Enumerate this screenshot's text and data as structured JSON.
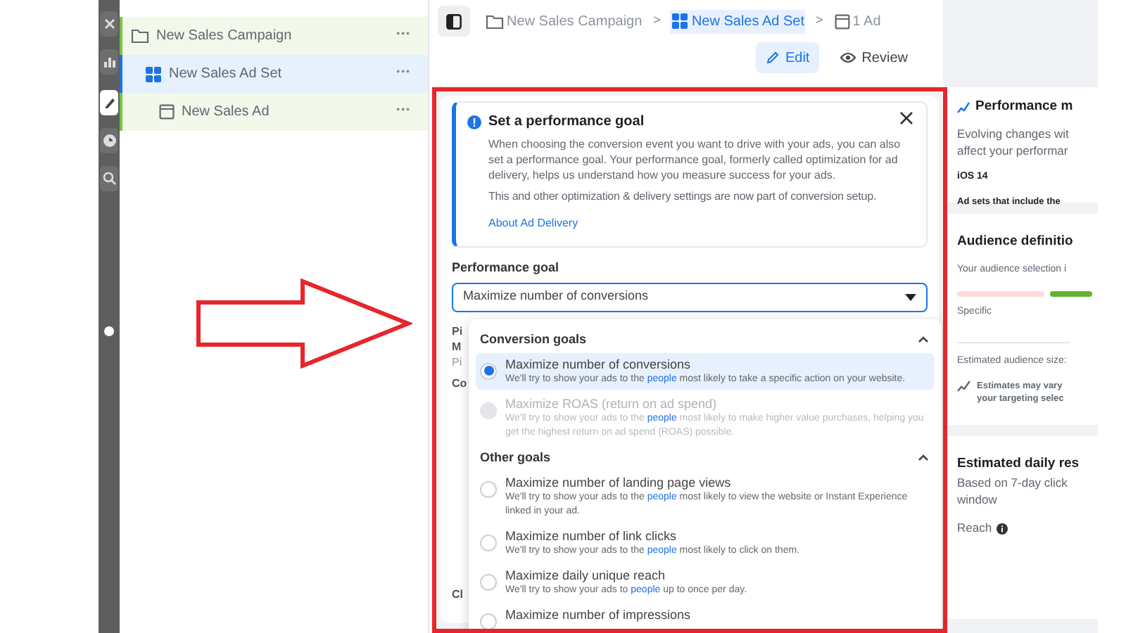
{
  "rail": [
    {
      "kind": "close",
      "selected": false
    },
    {
      "kind": "chart",
      "selected": false
    },
    {
      "kind": "pencil",
      "selected": true
    },
    {
      "kind": "clock",
      "selected": false
    },
    {
      "kind": "search",
      "selected": false
    }
  ],
  "tree": [
    {
      "label": "New Sales Campaign",
      "kind": "campaign",
      "selected": false,
      "more": "•••",
      "children": [
        {
          "label": "New Sales Ad Set",
          "kind": "adset",
          "selected": true,
          "more": "•••",
          "children": [
            {
              "label": "New Sales Ad",
              "kind": "ad",
              "selected": false,
              "more": "•••"
            }
          ]
        }
      ]
    }
  ],
  "breadcrumb": [
    {
      "label": "New Sales Campaign",
      "kind": "campaign",
      "selected": false
    },
    {
      "label": "New Sales Ad Set",
      "kind": "adset",
      "selected": true
    },
    {
      "label": "1 Ad",
      "kind": "ad",
      "selected": false
    }
  ],
  "separator": ">",
  "mode_tabs": [
    {
      "label": "Edit",
      "kind": "edit",
      "selected": true
    },
    {
      "label": "Review",
      "kind": "review",
      "selected": false
    }
  ],
  "notice": {
    "title": "Set a performance goal",
    "body": "When choosing the conversion event you want to drive with your ads, you can also set a performance goal. Your performance goal, formerly called optimization for ad delivery, helps us understand how you measure success for your ads.",
    "note": "This and other optimization & delivery settings are now part of conversion setup.",
    "link": "About Ad Delivery"
  },
  "performance_goal": {
    "label": "Performance goal",
    "value": "Maximize number of conversions"
  },
  "hidden_labels": [
    "Pi",
    "M",
    "Pi",
    "Co",
    "Cl"
  ],
  "dropdown": {
    "groups": [
      {
        "title": "Conversion goals",
        "expanded": true,
        "options": [
          {
            "title": "Maximize number of conversions",
            "desc": {
              "before": "We'll try to show your ads to the",
              "link": "people",
              "after": "most likely to take a specific action on your website."
            },
            "selected": true,
            "disabled": false
          },
          {
            "title": "Maximize ROAS (return on ad spend)",
            "desc": {
              "before": "We'll try to show your ads to the",
              "link": "people",
              "after": "most likely to make higher value purchases, helping you get the highest return on ad spend (ROAS) possible."
            },
            "selected": false,
            "disabled": true
          }
        ]
      },
      {
        "title": "Other goals",
        "expanded": true,
        "options": [
          {
            "title": "Maximize number of landing page views",
            "desc": {
              "before": "We'll try to show your ads to the",
              "link": "people",
              "after": "most likely to view the website or Instant Experience linked in your ad."
            },
            "selected": false,
            "disabled": false
          },
          {
            "title": "Maximize number of link clicks",
            "desc": {
              "before": "We'll try to show your ads to the",
              "link": "people",
              "after": "most likely to click on them."
            },
            "selected": false,
            "disabled": false
          },
          {
            "title": "Maximize daily unique reach",
            "desc": {
              "before": "We'll try to show your ads to",
              "link": "people",
              "after": "up to once per day."
            },
            "selected": false,
            "disabled": false
          },
          {
            "title": "Maximize number of impressions",
            "selected": false,
            "disabled": false
          }
        ]
      }
    ]
  },
  "right_panel": {
    "performance": {
      "title": "Performance m",
      "body": [
        "Evolving changes wit",
        "affect your performar"
      ],
      "subtitle": "iOS 14",
      "note": "Ad sets that include the"
    },
    "audience": {
      "title": "Audience definitio",
      "body": "Your audience selection i",
      "scale_label": "Specific",
      "size_label": "Estimated audience size:",
      "estimate_note": [
        "Estimates may vary",
        "your targeting selec"
      ]
    },
    "daily": {
      "title": "Estimated daily res",
      "body": [
        "Based on 7-day click",
        "window"
      ],
      "reach": "Reach"
    }
  }
}
